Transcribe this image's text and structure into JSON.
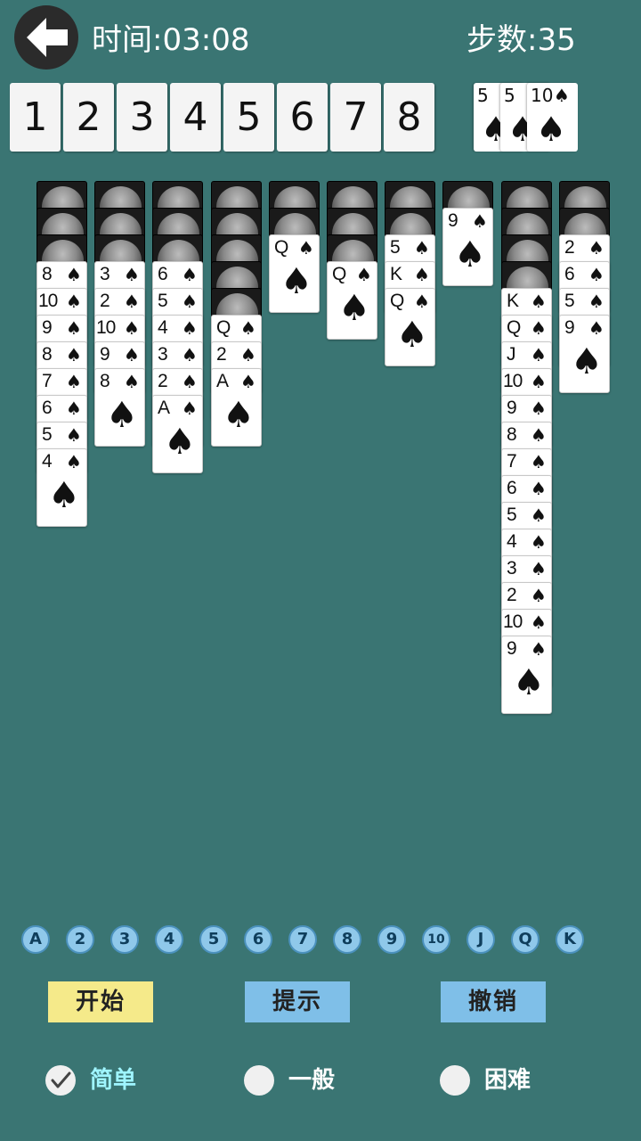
{
  "header": {
    "time_label": "时间:",
    "time_value": "03:08",
    "steps_label": "步数:",
    "steps_value": "35"
  },
  "foundation_slots": [
    "1",
    "2",
    "3",
    "4",
    "5",
    "6",
    "7",
    "8"
  ],
  "stock_cards": [
    {
      "rank": "5",
      "suit": "♠"
    },
    {
      "rank": "5",
      "suit": "♠"
    },
    {
      "rank": "10",
      "suit": "♠"
    }
  ],
  "suit_symbol": "♠",
  "tableau": [
    {
      "face_down": 3,
      "face_up": [
        "8",
        "10",
        "9",
        "8",
        "7",
        "6",
        "5",
        "4"
      ]
    },
    {
      "face_down": 3,
      "face_up": [
        "3",
        "2",
        "10",
        "9",
        "8"
      ]
    },
    {
      "face_down": 3,
      "face_up": [
        "6",
        "5",
        "4",
        "3",
        "2",
        "A"
      ]
    },
    {
      "face_down": 5,
      "face_up": [
        "Q",
        "2",
        "A"
      ]
    },
    {
      "face_down": 2,
      "face_up": [
        "Q"
      ]
    },
    {
      "face_down": 3,
      "face_up": [
        "Q"
      ]
    },
    {
      "face_down": 2,
      "face_up": [
        "5",
        "K",
        "Q"
      ]
    },
    {
      "face_down": 1,
      "face_up": [
        "9"
      ]
    },
    {
      "face_down": 4,
      "face_up": [
        "K",
        "Q",
        "J",
        "10",
        "9",
        "8",
        "7",
        "6",
        "5",
        "4",
        "3",
        "2",
        "10",
        "9"
      ]
    },
    {
      "face_down": 2,
      "face_up": [
        "2",
        "6",
        "5",
        "9"
      ]
    }
  ],
  "rank_selector": [
    "A",
    "2",
    "3",
    "4",
    "5",
    "6",
    "7",
    "8",
    "9",
    "10",
    "J",
    "Q",
    "K"
  ],
  "actions": {
    "start": "开始",
    "hint": "提示",
    "undo": "撤销"
  },
  "difficulty_options": [
    {
      "label": "简单",
      "selected": true
    },
    {
      "label": "一般",
      "selected": false
    },
    {
      "label": "困难",
      "selected": false
    }
  ],
  "colors": {
    "background": "#3a7573",
    "start_button": "#f5ea8a",
    "hint_button": "#7fbfe8",
    "undo_button": "#7fbfe8",
    "selected_difficulty_text": "#9ff5ff"
  }
}
